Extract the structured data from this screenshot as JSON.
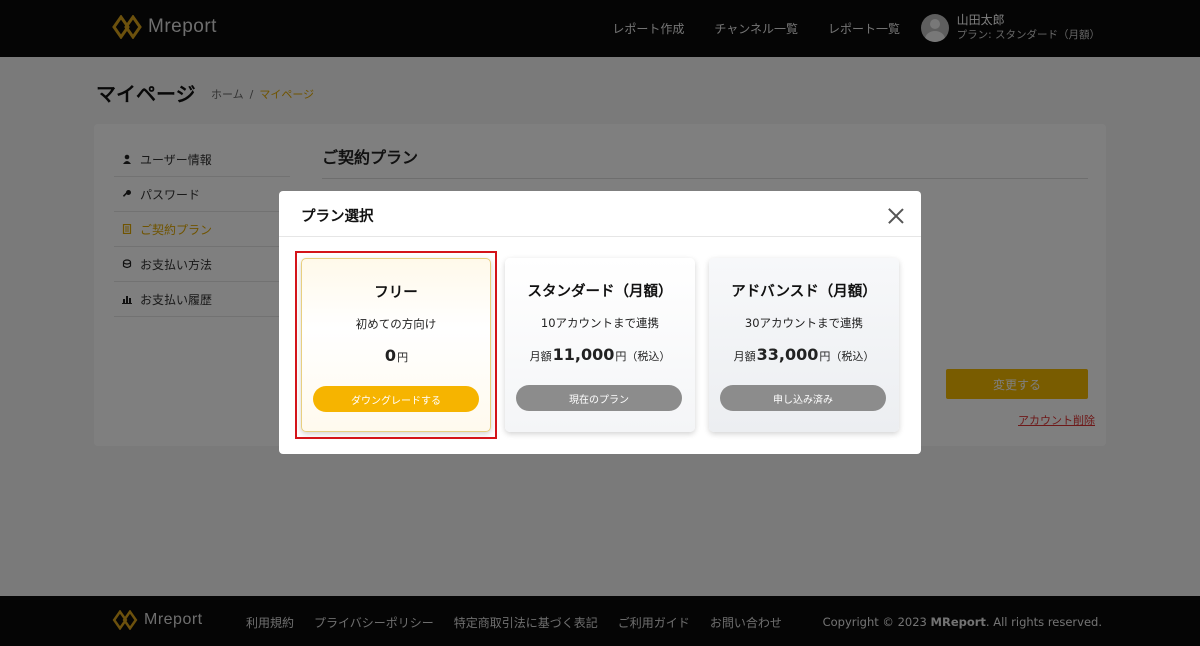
{
  "header": {
    "logo_text": "Mreport",
    "nav": [
      "レポート作成",
      "チャンネル一覧",
      "レポート一覧"
    ],
    "user_name": "山田太郎",
    "user_plan": "プラン: スタンダード（月額）"
  },
  "page": {
    "title": "マイページ",
    "breadcrumb": {
      "home": "ホーム",
      "sep": "/",
      "current": "マイページ"
    }
  },
  "sidebar": {
    "items": [
      {
        "label": "ユーザー情報",
        "icon": "user-icon"
      },
      {
        "label": "パスワード",
        "icon": "key-icon"
      },
      {
        "label": "ご契約プラン",
        "icon": "document-icon",
        "active": true
      },
      {
        "label": "お支払い方法",
        "icon": "coin-icon"
      },
      {
        "label": "お支払い履歴",
        "icon": "chart-icon"
      }
    ]
  },
  "content": {
    "title": "ご契約プラン",
    "change_button": "変更する",
    "delete_link": "アカウント削除"
  },
  "modal": {
    "title": "プラン選択",
    "plans": [
      {
        "name": "フリー",
        "desc": "初めての方向け",
        "price_prefix": "",
        "price": "0",
        "unit": "円",
        "tax": "",
        "button": "ダウングレードする"
      },
      {
        "name": "スタンダード（月額）",
        "desc": "10アカウントまで連携",
        "price_prefix": "月額",
        "price": "11,000",
        "unit": "円",
        "tax": "（税込）",
        "button": "現在のプラン"
      },
      {
        "name": "アドバンスド（月額）",
        "desc": "30アカウントまで連携",
        "price_prefix": "月額",
        "price": "33,000",
        "unit": "円",
        "tax": "（税込）",
        "button": "申し込み済み"
      }
    ]
  },
  "footer": {
    "logo_text": "Mreport",
    "links": [
      "利用規約",
      "プライバシーポリシー",
      "特定商取引法に基づく表記",
      "ご利用ガイド",
      "お問い合わせ"
    ],
    "copyright_prefix": "Copyright © 2023 ",
    "copyright_brand": "MReport",
    "copyright_suffix": ". All rights reserved."
  },
  "colors": {
    "accent": "#f3b800",
    "header_bg": "#0a0a0a",
    "highlight": "#d4141a"
  }
}
